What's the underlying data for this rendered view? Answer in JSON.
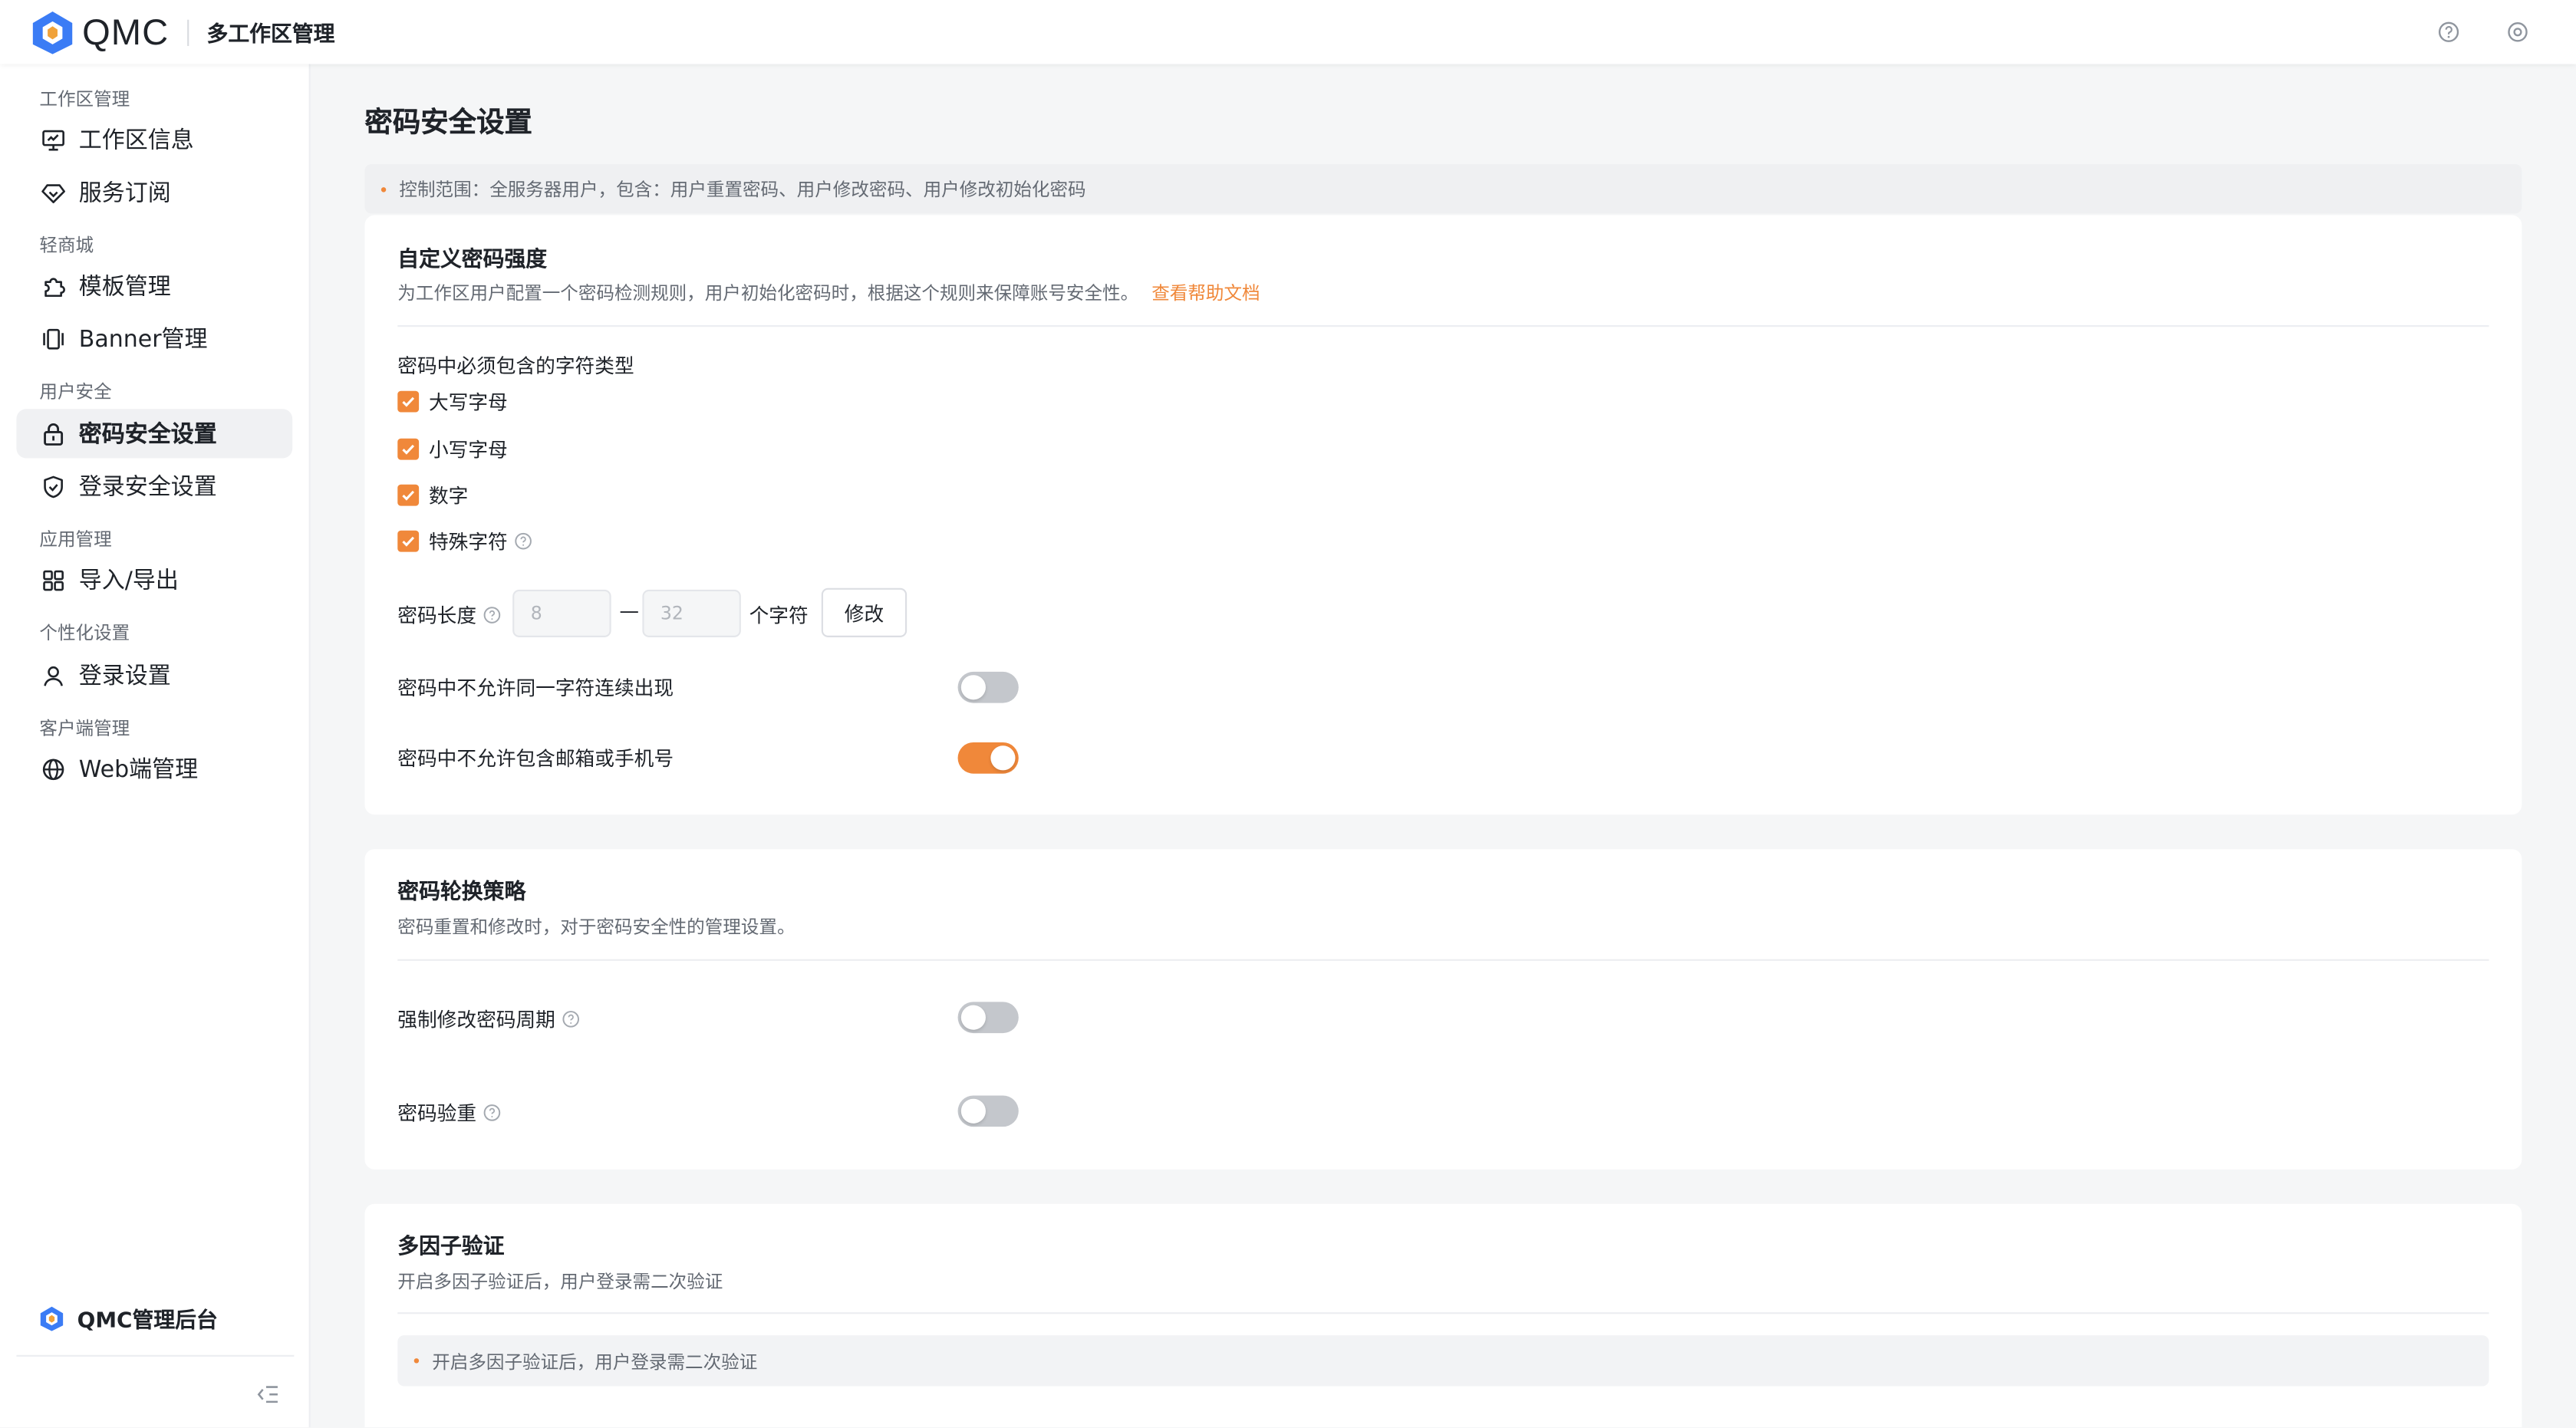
{
  "app": {
    "logo_text": "QMC",
    "section_title": "多工作区管理"
  },
  "sidebar": {
    "groups": [
      {
        "label": "工作区管理",
        "items": [
          {
            "label": "工作区信息",
            "icon": "monitor-icon"
          },
          {
            "label": "服务订阅",
            "icon": "diamond-icon"
          }
        ]
      },
      {
        "label": "轻商城",
        "items": [
          {
            "label": "模板管理",
            "icon": "puzzle-icon"
          },
          {
            "label": "Banner管理",
            "icon": "carousel-icon"
          }
        ]
      },
      {
        "label": "用户安全",
        "items": [
          {
            "label": "密码安全设置",
            "icon": "lock-icon",
            "active": true
          },
          {
            "label": "登录安全设置",
            "icon": "shield-icon"
          }
        ]
      },
      {
        "label": "应用管理",
        "items": [
          {
            "label": "导入/导出",
            "icon": "grid-icon"
          }
        ]
      },
      {
        "label": "个性化设置",
        "items": [
          {
            "label": "登录设置",
            "icon": "user-icon"
          }
        ]
      },
      {
        "label": "客户端管理",
        "items": [
          {
            "label": "Web端管理",
            "icon": "globe-icon"
          }
        ]
      }
    ],
    "bottom_label": "QMC管理后台"
  },
  "main": {
    "title": "密码安全设置",
    "notice": "控制范围：全服务器用户，包含：用户重置密码、用户修改密码、用户修改初始化密码",
    "strength": {
      "title": "自定义密码强度",
      "desc": "为工作区用户配置一个密码检测规则，用户初始化密码时，根据这个规则来保障账号安全性。",
      "help_link": "查看帮助文档",
      "char_types_label": "密码中必须包含的字符类型",
      "char_types": [
        {
          "label": "大写字母",
          "checked": true
        },
        {
          "label": "小写字母",
          "checked": true
        },
        {
          "label": "数字",
          "checked": true
        },
        {
          "label": "特殊字符",
          "checked": true
        }
      ],
      "length_label": "密码长度",
      "min_length": "8",
      "dash": "—",
      "max_length": "32",
      "unit": "个字符",
      "edit_button": "修改",
      "no_repeat_label": "密码中不允许同一字符连续出现",
      "no_repeat_on": false,
      "no_contact_label": "密码中不允许包含邮箱或手机号",
      "no_contact_on": true
    },
    "rotation": {
      "title": "密码轮换策略",
      "desc": "密码重置和修改时，对于密码安全性的管理设置。",
      "force_label": "强制修改密码周期",
      "force_on": false,
      "dup_label": "密码验重",
      "dup_on": false
    },
    "mfa": {
      "title": "多因子验证",
      "desc": "开启多因子验证后，用户登录需二次验证",
      "note": "开启多因子验证后，用户登录需二次验证"
    }
  },
  "colors": {
    "accent": "#f0883a",
    "toggle_off": "#c4c7cc",
    "brand_blue": "#3b7cf5"
  }
}
